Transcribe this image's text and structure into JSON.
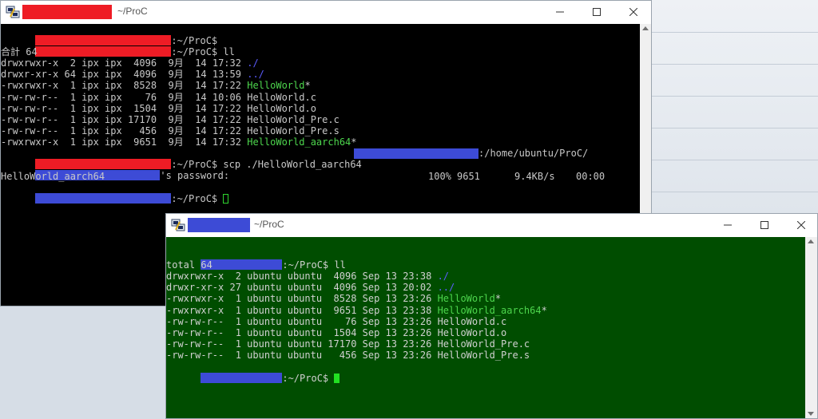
{
  "colors": {
    "redact_red": "#ee1c25",
    "redact_blue": "#3d4bd6",
    "term1_bg": "#000000",
    "term1_fg": "#c8c8c8",
    "term2_bg": "#004d00",
    "term2_fg": "#d0d0d0",
    "dir_blue": "#5c5cff",
    "exec_green": "#4dd64d"
  },
  "window1": {
    "title": "~/ProC",
    "prompt_suffix_1": ":~/ProC$",
    "prompt_suffix_2": ":~/ProC$ ll",
    "total": "合計 64",
    "rows": [
      {
        "meta": "drwxrwxr-x  2 ipx ipx  4096  9月  14 17:32 ",
        "name": "./",
        "kind": "dir",
        "mark": ""
      },
      {
        "meta": "drwxr-xr-x 64 ipx ipx  4096  9月  14 13:59 ",
        "name": "../",
        "kind": "dir",
        "mark": ""
      },
      {
        "meta": "-rwxrwxr-x  1 ipx ipx  8528  9月  14 17:22 ",
        "name": "HelloWorld",
        "kind": "exec",
        "mark": "*"
      },
      {
        "meta": "-rw-rw-r--  1 ipx ipx    76  9月  14 10:06 ",
        "name": "HelloWorld.c",
        "kind": "file",
        "mark": ""
      },
      {
        "meta": "-rw-rw-r--  1 ipx ipx  1504  9月  14 17:22 ",
        "name": "HelloWorld.o",
        "kind": "file",
        "mark": ""
      },
      {
        "meta": "-rw-rw-r--  1 ipx ipx 17170  9月  14 17:22 ",
        "name": "HelloWorld_Pre.c",
        "kind": "file",
        "mark": ""
      },
      {
        "meta": "-rw-rw-r--  1 ipx ipx   456  9月  14 17:22 ",
        "name": "HelloWorld_Pre.s",
        "kind": "file",
        "mark": ""
      },
      {
        "meta": "-rwxrwxr-x  1 ipx ipx  9651  9月  14 17:32 ",
        "name": "HelloWorld_aarch64",
        "kind": "exec",
        "mark": "*"
      }
    ],
    "scp_cmd": ":~/ProC$ scp ./HelloWorld_aarch64",
    "scp_dest": ":/home/ubuntu/ProC/",
    "password_prompt": "'s password:",
    "transfer": {
      "file": "HelloWorld_aarch64",
      "percent": "100%",
      "size": "9651",
      "rate": "9.4KB/s",
      "time": "00:00"
    },
    "final_prompt": ":~/ProC$"
  },
  "window2": {
    "title": "~/ProC",
    "prompt_cmd": ":~/ProC$ ll",
    "total": "total 64",
    "rows": [
      {
        "meta": "drwxrwxr-x  2 ubuntu ubuntu  4096 Sep 13 23:38 ",
        "name": "./",
        "kind": "dir",
        "mark": ""
      },
      {
        "meta": "drwxr-xr-x 27 ubuntu ubuntu  4096 Sep 13 20:02 ",
        "name": "../",
        "kind": "dir",
        "mark": ""
      },
      {
        "meta": "-rwxrwxr-x  1 ubuntu ubuntu  8528 Sep 13 23:26 ",
        "name": "HelloWorld",
        "kind": "exec",
        "mark": "*"
      },
      {
        "meta": "-rwxrwxr-x  1 ubuntu ubuntu  9651 Sep 13 23:38 ",
        "name": "HelloWorld_aarch64",
        "kind": "exec",
        "mark": "*"
      },
      {
        "meta": "-rw-rw-r--  1 ubuntu ubuntu    76 Sep 13 23:26 ",
        "name": "HelloWorld.c",
        "kind": "file",
        "mark": ""
      },
      {
        "meta": "-rw-rw-r--  1 ubuntu ubuntu  1504 Sep 13 23:26 ",
        "name": "HelloWorld.o",
        "kind": "file",
        "mark": ""
      },
      {
        "meta": "-rw-rw-r--  1 ubuntu ubuntu 17170 Sep 13 23:26 ",
        "name": "HelloWorld_Pre.c",
        "kind": "file",
        "mark": ""
      },
      {
        "meta": "-rw-rw-r--  1 ubuntu ubuntu   456 Sep 13 23:26 ",
        "name": "HelloWorld_Pre.s",
        "kind": "file",
        "mark": ""
      }
    ],
    "final_prompt": ":~/ProC$"
  }
}
